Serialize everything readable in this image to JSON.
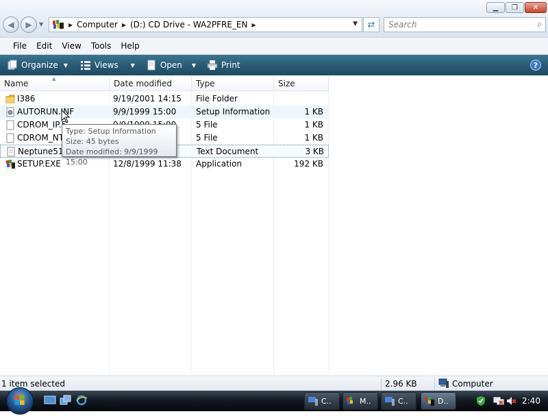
{
  "address_bar": {
    "breadcrumbs": [
      "Computer",
      "(D:) CD Drive - WA2PFRE_EN"
    ],
    "search_placeholder": "Search"
  },
  "menu": [
    "File",
    "Edit",
    "View",
    "Tools",
    "Help"
  ],
  "commands": [
    "Organize",
    "Views",
    "Open",
    "Print"
  ],
  "columns": [
    "Name",
    "Date modified",
    "Type",
    "Size"
  ],
  "files": [
    {
      "name": "I386",
      "date": "9/19/2001 14:15",
      "type": "File Folder",
      "size": "",
      "icon": "folder-icon"
    },
    {
      "name": "AUTORUN.INF",
      "date": "9/9/1999 15:00",
      "type": "Setup Information",
      "size": "1 KB",
      "icon": "setup-file-icon"
    },
    {
      "name": "CDROM_IP.5",
      "date": "9/9/1999 15:00",
      "type": "5 File",
      "size": "1 KB",
      "icon": "blank-file-icon"
    },
    {
      "name": "CDROM_NT.5",
      "date": "9/9/1999 15:00",
      "type": "5 File",
      "size": "1 KB",
      "icon": "blank-file-icon"
    },
    {
      "name": "Neptune511.txt",
      "date": "9/9/1999 15:00",
      "type": "Text Document",
      "size": "3 KB",
      "icon": "text-file-icon"
    },
    {
      "name": "SETUP.EXE",
      "date": "12/8/1999 11:38",
      "type": "Application",
      "size": "192 KB",
      "icon": "setup-exe-icon"
    }
  ],
  "tooltip": {
    "type": "Type: Setup Information",
    "size": "Size: 45 bytes",
    "date": "Date modified: 9/9/1999 15:00"
  },
  "status": {
    "selection": "1 item selected",
    "size": "2.96 KB",
    "location": "Computer"
  },
  "taskbar": {
    "buttons": [
      "C..",
      "M..",
      "C..",
      "D.."
    ],
    "clock": "2:40"
  }
}
